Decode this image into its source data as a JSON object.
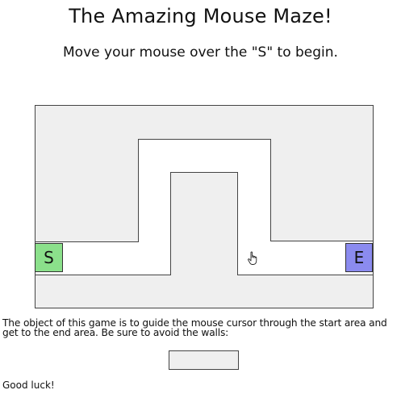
{
  "title": "The Amazing Mouse Maze!",
  "subtitle": "Move your mouse over the \"S\" to begin.",
  "maze": {
    "start_label": "S",
    "end_label": "E",
    "start_color": "#8be08b",
    "end_color": "#8b8bef",
    "wall_color": "#efefef",
    "cursor_icon": "hand-pointer-icon"
  },
  "instructions": "The object of this game is to guide the mouse cursor through the start area and get to the end area. Be sure to avoid the walls:",
  "closing": "Good luck!"
}
